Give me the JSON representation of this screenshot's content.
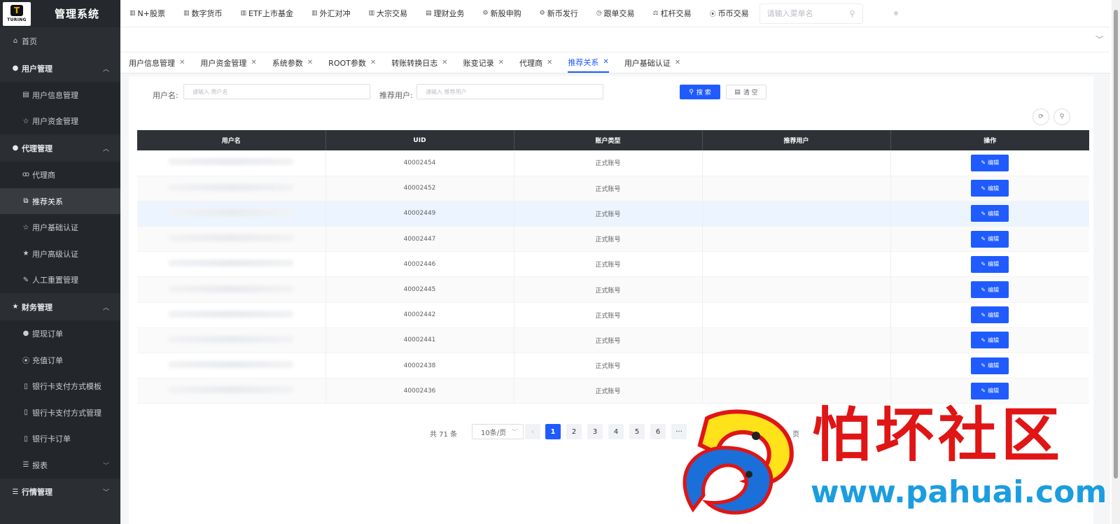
{
  "brand": {
    "logo_text": "TURING",
    "logo_mark": "T",
    "title": "管理系统"
  },
  "sidebar": {
    "home": {
      "label": "首页",
      "icon": "home-icon"
    },
    "groups": [
      {
        "label": "用户管理",
        "icon": "user-icon",
        "expanded": true,
        "items": [
          {
            "label": "用户信息管理",
            "icon": "id-card-icon"
          },
          {
            "label": "用户资金管理",
            "icon": "star-outline-icon"
          }
        ]
      },
      {
        "label": "代理管理",
        "icon": "user-icon",
        "expanded": true,
        "items": [
          {
            "label": "代理商",
            "icon": "agent-icon"
          },
          {
            "label": "推荐关系",
            "icon": "relation-icon",
            "active": true
          },
          {
            "label": "用户基础认证",
            "icon": "star-outline-icon"
          },
          {
            "label": "用户高级认证",
            "icon": "star-icon"
          },
          {
            "label": "人工重置管理",
            "icon": "edit-icon"
          }
        ]
      },
      {
        "label": "财务管理",
        "icon": "star-icon",
        "expanded": true,
        "items": [
          {
            "label": "提现订单",
            "icon": "user-icon"
          },
          {
            "label": "充值订单",
            "icon": "location-icon"
          },
          {
            "label": "银行卡支付方式模板",
            "icon": "document-icon"
          },
          {
            "label": "银行卡支付方式管理",
            "icon": "document-icon"
          },
          {
            "label": "银行卡订单",
            "icon": "document-icon"
          },
          {
            "label": "报表",
            "icon": "list-icon",
            "collapsible": true
          }
        ]
      },
      {
        "label": "行情管理",
        "icon": "list-icon",
        "expanded": false,
        "items": []
      }
    ]
  },
  "topnav": {
    "items": [
      {
        "label": "N+股票",
        "icon": "bar-chart-icon"
      },
      {
        "label": "数字货币",
        "icon": "bar-chart-icon"
      },
      {
        "label": "ETF上市基金",
        "icon": "bar-chart-icon"
      },
      {
        "label": "外汇对冲",
        "icon": "bar-chart-icon"
      },
      {
        "label": "大宗交易",
        "icon": "bar-chart-icon"
      },
      {
        "label": "理财业务",
        "icon": "document-icon"
      },
      {
        "label": "新股申购",
        "icon": "gear-icon"
      },
      {
        "label": "新币发行",
        "icon": "gear-icon"
      },
      {
        "label": "跟单交易",
        "icon": "clock-icon"
      },
      {
        "label": "杠杆交易",
        "icon": "lever-icon"
      },
      {
        "label": "币币交易",
        "icon": "location-icon"
      }
    ],
    "search_placeholder": "请输入菜单名"
  },
  "tabs": [
    {
      "label": "用户信息管理"
    },
    {
      "label": "用户资金管理"
    },
    {
      "label": "系统参数"
    },
    {
      "label": "ROOT参数"
    },
    {
      "label": "转账转换日志"
    },
    {
      "label": "账变记录"
    },
    {
      "label": "代理商"
    },
    {
      "label": "推荐关系",
      "active": true
    },
    {
      "label": "用户基础认证"
    }
  ],
  "filter": {
    "username_label": "用户名:",
    "username_placeholder": "请输入 用户名",
    "referrer_label": "推荐用户:",
    "referrer_placeholder": "请输入 推荐用户",
    "search_button": "搜 索",
    "clear_button": "清 空"
  },
  "table": {
    "columns": [
      "用户名",
      "UID",
      "账户类型",
      "推荐用户",
      "操作"
    ],
    "edit_label": "编辑",
    "rows": [
      {
        "uid": "40002454",
        "type": "正式账号"
      },
      {
        "uid": "40002452",
        "type": "正式账号"
      },
      {
        "uid": "40002449",
        "type": "正式账号"
      },
      {
        "uid": "40002447",
        "type": "正式账号"
      },
      {
        "uid": "40002446",
        "type": "正式账号"
      },
      {
        "uid": "40002445",
        "type": "正式账号"
      },
      {
        "uid": "40002442",
        "type": "正式账号"
      },
      {
        "uid": "40002441",
        "type": "正式账号"
      },
      {
        "uid": "40002438",
        "type": "正式账号"
      },
      {
        "uid": "40002436",
        "type": "正式账号"
      }
    ]
  },
  "pagination": {
    "total_text": "共 71 条",
    "page_size": "10条/页",
    "prev": "‹",
    "pages": [
      "1",
      "2",
      "3",
      "4",
      "5",
      "6"
    ],
    "ellipsis": "···",
    "current_page": "1",
    "tail_text": "页"
  },
  "watermark": {
    "title": "怕坏社区",
    "url": "www.pahuai.com"
  },
  "colors": {
    "primary": "#1f5bff",
    "sidebar_bg": "#2b2f33",
    "table_header": "#2e3236",
    "status_green": "#3bb54a",
    "watermark_red": "#e01515",
    "watermark_blue": "#1b9de0"
  }
}
